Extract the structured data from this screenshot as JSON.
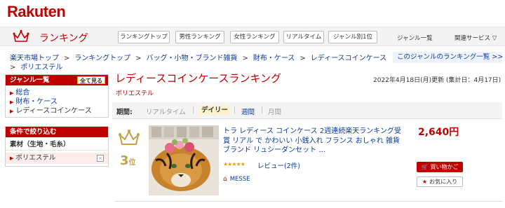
{
  "brand": {
    "logo_text": "Rakuten",
    "color": "#bf0000"
  },
  "ranking_bar": {
    "title": "ランキング",
    "buttons": [
      "ランキングトップ",
      "男性ランキング",
      "女性ランキング",
      "リアルタイム",
      "ジャンル別1位"
    ],
    "plain_links": [
      "ジャンル一覧",
      "関連サービス ▽"
    ]
  },
  "breadcrumb": {
    "items": [
      "楽天市場トップ",
      "ランキングトップ",
      "バッグ・小物・ブランド雑貨",
      "財布・ケース",
      "レディースコインケース",
      "ポリエステル"
    ],
    "separator": ">"
  },
  "this_genre_link": "このジャンルのランキング一覧 >>",
  "sidebar": {
    "genre_header": "ジャンル一覧",
    "all_button": "全て見る",
    "genres": [
      "総合",
      "財布・ケース",
      "レディースコインケース"
    ],
    "filter_header": "条件で絞り込む",
    "filter_section": "素材（生地・毛糸）",
    "filter_chip": "ポリエステル",
    "chip_close": "×"
  },
  "main": {
    "title": "レディースコインケースランキング",
    "updated": "2022年4月18日(月)更新 (集計日：4月17日)",
    "subcategory": "ポリエステル"
  },
  "period": {
    "label": "期間:",
    "options": [
      {
        "label": "リアルタイム",
        "state": "disabled"
      },
      {
        "label": "デイリー",
        "state": "active"
      },
      {
        "label": "週間",
        "state": "link"
      },
      {
        "label": "月間",
        "state": "disabled"
      }
    ]
  },
  "item": {
    "rank": "3",
    "rank_suffix": "位",
    "title": "トラ レディース コインケース 2週連続楽天ランキング受賞 リアル で かわいい 小銭入れ フランス おしゃれ 雑貨 ブランド リュシーダンセット …",
    "stars": "★★★★★",
    "review": "レビュー(2件)",
    "shop": "MESSE",
    "price": "2,640円",
    "cart_label": "買い物かご",
    "fav_label": "お気に入り"
  }
}
